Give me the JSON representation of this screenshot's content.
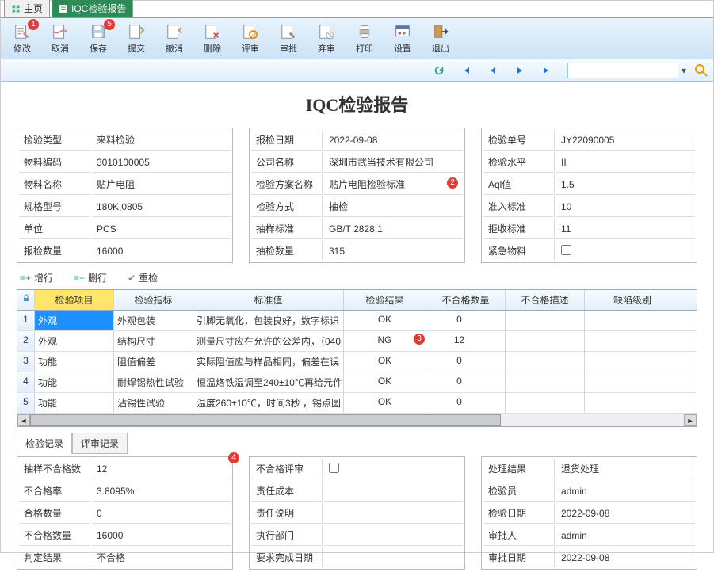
{
  "tabs": {
    "home": "主页",
    "report": "IQC检验报告"
  },
  "toolbar": {
    "modify": "修改",
    "cancel": "取消",
    "save": "保存",
    "submit": "提交",
    "revoke": "撤消",
    "delete": "删除",
    "review": "评审",
    "approve": "审批",
    "discard": "弃审",
    "print": "打印",
    "settings": "设置",
    "exit": "退出"
  },
  "badges": {
    "modify": "1",
    "save": "5",
    "scheme": "2",
    "row_ng": "3",
    "left_panel": "4"
  },
  "title": "IQC检验报告",
  "p1": {
    "insp_type_l": "检验类型",
    "insp_type": "来料检验",
    "mat_code_l": "物料编码",
    "mat_code": "3010100005",
    "mat_name_l": "物料名称",
    "mat_name": "贴片电阻",
    "spec_l": "规格型号",
    "spec": "180K,0805",
    "unit_l": "单位",
    "unit": "PCS",
    "rep_qty_l": "报检数量",
    "rep_qty": "16000"
  },
  "p2": {
    "rep_date_l": "报检日期",
    "rep_date": "2022-09-08",
    "company_l": "公司名称",
    "company": "深圳市武当技术有限公司",
    "scheme_l": "检验方案名称",
    "scheme": "贴片电阻检验标准",
    "method_l": "检验方式",
    "method": "抽检",
    "sample_std_l": "抽样标准",
    "sample_std": "GB/T 2828.1",
    "sample_qty_l": "抽检数量",
    "sample_qty": "315"
  },
  "p3": {
    "doc_no_l": "检验单号",
    "doc_no": "JY22090005",
    "level_l": "检验水平",
    "level": "II",
    "aql_l": "Aql值",
    "aql": "1.5",
    "accept_l": "准入标准",
    "accept": "10",
    "reject_l": "拒收标准",
    "reject": "11",
    "urgent_l": "紧急物料"
  },
  "grid_tools": {
    "add": "增行",
    "del": "删行",
    "recheck": "重检"
  },
  "grid_headers": [
    "",
    "检验项目",
    "检验指标",
    "标准值",
    "检验结果",
    "不合格数量",
    "不合格描述",
    "缺陷级别"
  ],
  "grid_rows": [
    {
      "n": "1",
      "item": "外观",
      "metric": "外观包装",
      "std": "引脚无氧化，包装良好，数字标识",
      "res": "OK",
      "nc": "0"
    },
    {
      "n": "2",
      "item": "外观",
      "metric": "结构尺寸",
      "std": "测量尺寸应在允许的公差内，（040",
      "res": "NG",
      "nc": "12"
    },
    {
      "n": "3",
      "item": "功能",
      "metric": "阻值偏差",
      "std": "实际阻值应与样品相同，偏差在误",
      "res": "OK",
      "nc": "0"
    },
    {
      "n": "4",
      "item": "功能",
      "metric": "耐焊锡热性试验",
      "std": "恒温烙铁温调至240±10℃再给元件",
      "res": "OK",
      "nc": "0"
    },
    {
      "n": "5",
      "item": "功能",
      "metric": "沾锡性试验",
      "std": "温度260±10℃，时间3秒 ，锡点圆",
      "res": "OK",
      "nc": "0"
    }
  ],
  "subtabs": {
    "a": "检验记录",
    "b": "评审记录"
  },
  "b1": {
    "nc_sample_l": "抽样不合格数",
    "nc_sample": "12",
    "nc_rate_l": "不合格率",
    "nc_rate": "3.8095%",
    "pass_qty_l": "合格数量",
    "pass_qty": "0",
    "fail_qty_l": "不合格数量",
    "fail_qty": "16000",
    "verdict_l": "判定结果",
    "verdict": "不合格"
  },
  "b2": {
    "nc_review_l": "不合格评审",
    "cost_l": "责任成本",
    "desc_l": "责任说明",
    "dept_l": "执行部门",
    "due_l": "要求完成日期"
  },
  "b3": {
    "result_l": "处理结果",
    "result": "退货处理",
    "inspector_l": "检验员",
    "inspector": "admin",
    "insp_date_l": "检验日期",
    "insp_date": "2022-09-08",
    "approver_l": "审批人",
    "approver": "admin",
    "appr_date_l": "审批日期",
    "appr_date": "2022-09-08"
  },
  "search_placeholder": ""
}
